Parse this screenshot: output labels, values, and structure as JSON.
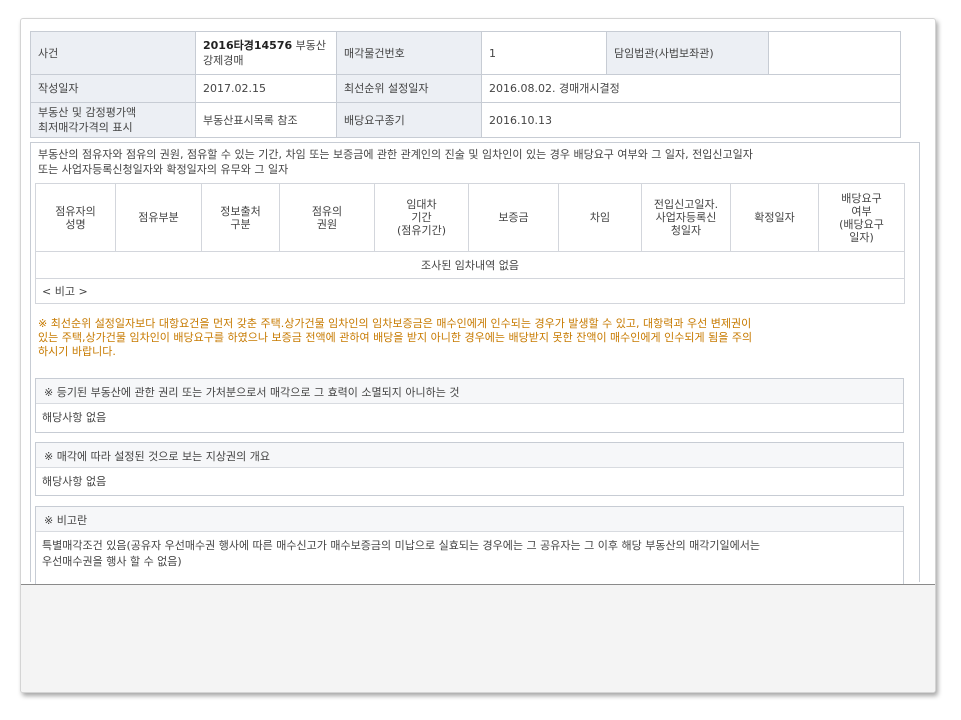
{
  "info": {
    "r1": {
      "label_case": "사건",
      "case_no": "2016타경14576",
      "case_type_1": "부동산",
      "case_type_2": "강제경매",
      "label_item_no": "매각물건번호",
      "item_no": "1",
      "label_judge": "담임법관(사법보좌관)",
      "judge": ""
    },
    "r2": {
      "label_date": "작성일자",
      "date": "2017.02.15",
      "label_priority": "최선순위 설정일자",
      "priority": "2016.08.02. 경매개시결정"
    },
    "r3": {
      "label_price_1": "부동산 및 감정평가액",
      "label_price_2": "최저매각가격의 표시",
      "price": "부동산표시목록 참조",
      "label_deadline": "배당요구종기",
      "deadline": "2016.10.13"
    }
  },
  "occupancy": {
    "title_1": "부동산의 점유자와 점유의 권원, 점유할 수 있는 기간, 차임 또는 보증금에 관한 관계인의 진술 및 임차인이 있는 경우 배당요구 여부와 그 일자, 전입신고일자",
    "title_2": "또는 사업자등록신청일자와 확정일자의 유무와 그 일자",
    "columns": [
      [
        "점유자의",
        "성명"
      ],
      [
        "점유부분"
      ],
      [
        "정보출처",
        "구분"
      ],
      [
        "점유의",
        "권원"
      ],
      [
        "임대차",
        "기간",
        "(점유기간)"
      ],
      [
        "보증금"
      ],
      [
        "차임"
      ],
      [
        "전입신고일자.",
        "사업자등록신",
        "청일자"
      ],
      [
        "확정일자"
      ],
      [
        "배당요구",
        "여부",
        "(배당요구",
        "일자)"
      ]
    ],
    "empty_text": "조사된 임차내역 없음",
    "remark": "< 비고 >"
  },
  "warning": {
    "line_1": "※ 최선순위 설정일자보다 대항요건을 먼저 갖춘 주택.상가건물 임차인의 임차보증금은 매수인에게 인수되는 경우가 발생할 수 있고, 대항력과 우선 변제권이",
    "line_2": "있는 주택,상가건물 임차인이 배당요구를 하였으나 보증금 전액에 관하여 배당을 받지 아니한 경우에는 배당받지 못한 잔액이 매수인에게 인수되게 됨을 주의",
    "line_3": "하시기 바랍니다."
  },
  "sections": [
    {
      "title": "※ 등기된 부동산에 관한 권리 또는 가처분으로서 매각으로 그 효력이 소멸되지 아니하는 것",
      "body": "해당사항 없음"
    },
    {
      "title": "※ 매각에 따라 설정된 것으로 보는 지상권의 개요",
      "body": "해당사항 없음"
    },
    {
      "title": "※ 비고란",
      "body_1": "특별매각조건 있음(공유자 우선매수권 행사에 따른 매수신고가 매수보증금의 미납으로 실효되는 경우에는 그 공유자는 그 이후 해당 부동산의 매각기일에서는",
      "body_2": "우선매수권을 행사 할 수 없음)"
    }
  ]
}
